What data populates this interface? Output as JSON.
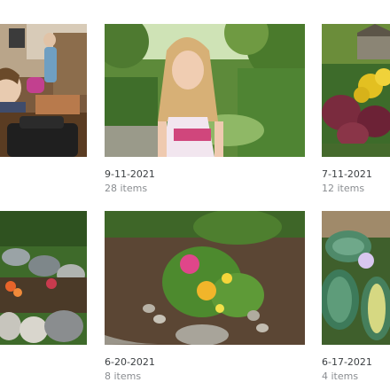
{
  "albums": [
    {
      "date": "",
      "count": "",
      "thumb": "kids-indoor-photo-thumbnail"
    },
    {
      "date": "9-11-2021",
      "count": "28 items",
      "thumb": "girl-in-garden-photo-thumbnail"
    },
    {
      "date": "7-11-2021",
      "count": "12 items",
      "thumb": "flower-garden-photo-thumbnail"
    },
    {
      "date": "",
      "count": "",
      "thumb": "rock-garden-photo-thumbnail"
    },
    {
      "date": "6-20-2021",
      "count": "8 items",
      "thumb": "zinnia-flowers-photo-thumbnail"
    },
    {
      "date": "6-17-2021",
      "count": "4 items",
      "thumb": "hosta-leaves-photo-thumbnail"
    }
  ]
}
